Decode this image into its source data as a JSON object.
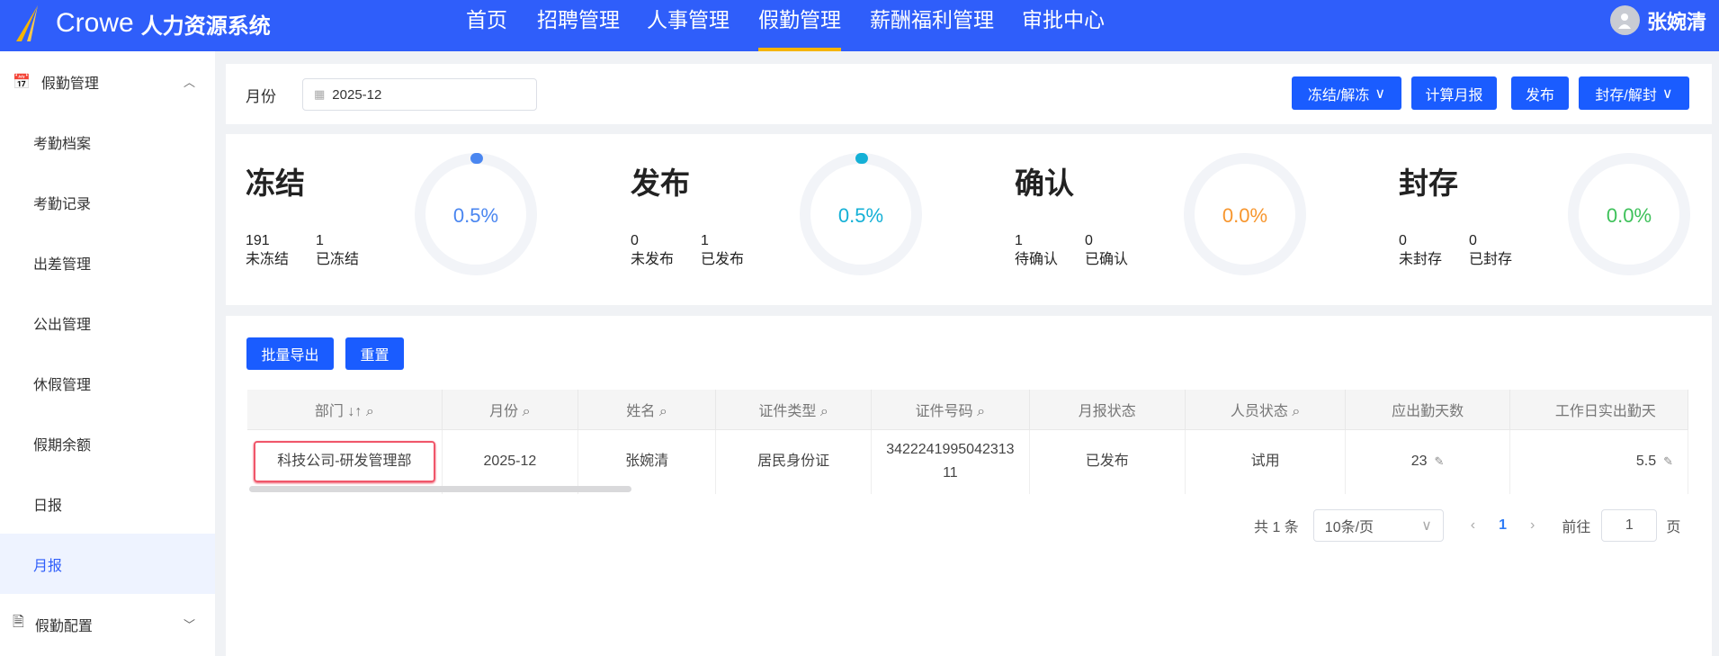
{
  "header": {
    "brand": "Crowe",
    "system": "人力资源系统",
    "nav": [
      "首页",
      "招聘管理",
      "人事管理",
      "假勤管理",
      "薪酬福利管理",
      "审批中心"
    ],
    "active_nav": "假勤管理",
    "user": "张婉清"
  },
  "sidebar": {
    "group1": "假勤管理",
    "items": [
      "考勤档案",
      "考勤记录",
      "出差管理",
      "公出管理",
      "休假管理",
      "假期余额",
      "日报",
      "月报"
    ],
    "active": "月报",
    "group2": "假勤配置"
  },
  "filter": {
    "month_label": "月份",
    "month_value": "2025-12",
    "buttons": [
      "冻结/解冻",
      "计算月报",
      "发布",
      "封存/解封"
    ]
  },
  "stats": [
    {
      "title": "冻结",
      "a_num": "191",
      "a_label": "未冻结",
      "b_num": "1",
      "b_label": "已冻结",
      "percent": "0.5%",
      "value": 0.5,
      "color": "#4a86f0"
    },
    {
      "title": "发布",
      "a_num": "0",
      "a_label": "未发布",
      "b_num": "1",
      "b_label": "已发布",
      "percent": "0.5%",
      "value": 0.5,
      "color": "#14b0d6"
    },
    {
      "title": "确认",
      "a_num": "1",
      "a_label": "待确认",
      "b_num": "0",
      "b_label": "已确认",
      "percent": "0.0%",
      "value": 0,
      "color": "#f7962e"
    },
    {
      "title": "封存",
      "a_num": "0",
      "a_label": "未封存",
      "b_num": "0",
      "b_label": "已封存",
      "percent": "0.0%",
      "value": 0,
      "color": "#3ec15a"
    }
  ],
  "actions": {
    "export": "批量导出",
    "reset": "重置"
  },
  "table": {
    "columns": [
      "部门",
      "月份",
      "姓名",
      "证件类型",
      "证件号码",
      "月报状态",
      "人员状态",
      "应出勤天数",
      "工作日实出勤天"
    ],
    "row": [
      "科技公司-研发管理部",
      "2025-12",
      "张婉清",
      "居民身份证",
      "342224199504231311",
      "已发布",
      "试用",
      "23",
      "5.5"
    ]
  },
  "pagination": {
    "total": "共 1 条",
    "page_size": "10条/页",
    "current": "1",
    "goto_label": "前往",
    "goto_value": "1",
    "page_suffix": "页"
  }
}
